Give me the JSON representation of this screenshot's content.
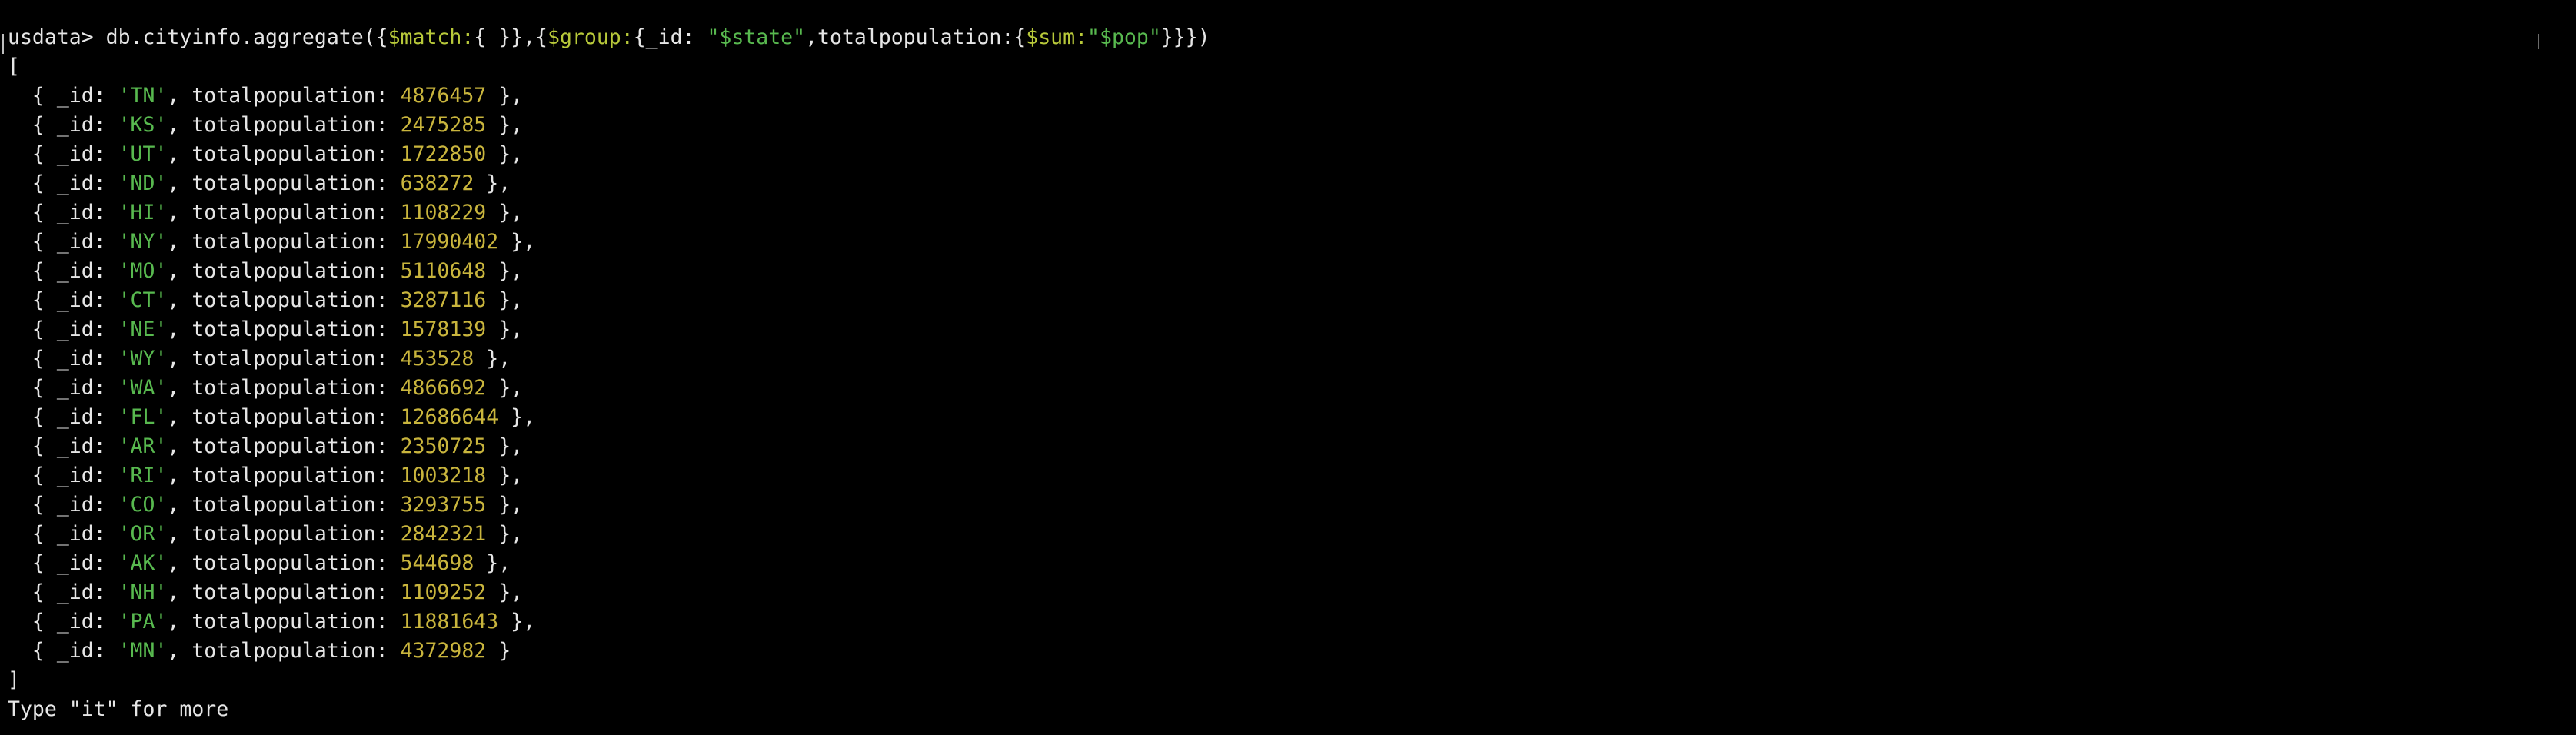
{
  "terminal": {
    "prompt": "usdata>",
    "command": {
      "p1": " db.cityinfo.aggregate({",
      "match_kw": "$match:",
      "p2": "{ }},{",
      "group_kw": "$group:",
      "p3": "{_id: ",
      "state_str": "\"$state\"",
      "p4": ",totalpopulation:{",
      "sum_kw": "$sum:",
      "pop_str": "\"$pop\"",
      "p5": "}}})"
    },
    "open_bracket": "[",
    "close_bracket": "]",
    "rows": [
      {
        "id": "'TN'",
        "pop": "4876457",
        "sep": " },"
      },
      {
        "id": "'KS'",
        "pop": "2475285",
        "sep": " },"
      },
      {
        "id": "'UT'",
        "pop": "1722850",
        "sep": " },"
      },
      {
        "id": "'ND'",
        "pop": "638272",
        "sep": " },"
      },
      {
        "id": "'HI'",
        "pop": "1108229",
        "sep": " },"
      },
      {
        "id": "'NY'",
        "pop": "17990402",
        "sep": " },"
      },
      {
        "id": "'MO'",
        "pop": "5110648",
        "sep": " },"
      },
      {
        "id": "'CT'",
        "pop": "3287116",
        "sep": " },"
      },
      {
        "id": "'NE'",
        "pop": "1578139",
        "sep": " },"
      },
      {
        "id": "'WY'",
        "pop": "453528",
        "sep": " },"
      },
      {
        "id": "'WA'",
        "pop": "4866692",
        "sep": " },"
      },
      {
        "id": "'FL'",
        "pop": "12686644",
        "sep": " },"
      },
      {
        "id": "'AR'",
        "pop": "2350725",
        "sep": " },"
      },
      {
        "id": "'RI'",
        "pop": "1003218",
        "sep": " },"
      },
      {
        "id": "'CO'",
        "pop": "3293755",
        "sep": " },"
      },
      {
        "id": "'OR'",
        "pop": "2842321",
        "sep": " },"
      },
      {
        "id": "'AK'",
        "pop": "544698",
        "sep": " },"
      },
      {
        "id": "'NH'",
        "pop": "1109252",
        "sep": " },"
      },
      {
        "id": "'PA'",
        "pop": "11881643",
        "sep": " },"
      },
      {
        "id": "'MN'",
        "pop": "4372982",
        "sep": " }"
      }
    ],
    "row_prefix": "  { _id: ",
    "row_key": ", totalpopulation: ",
    "footer": "Type \"it\" for more"
  },
  "colors": {
    "background": "#000000",
    "text": "#e6e6e6",
    "keyword": "#b8c93a",
    "string": "#58b94f",
    "number": "#c9b53d"
  }
}
